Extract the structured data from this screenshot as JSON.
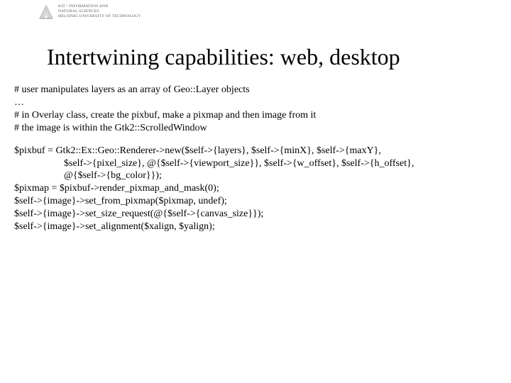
{
  "header": {
    "affil_line1": "KIT / INFORMATION AND",
    "affil_line2": "NATURAL SCIENCES",
    "affil_line3": "HELSINKI UNIVERSITY OF TECHNOLOGY"
  },
  "title": "Intertwining capabilities: web, desktop",
  "comments": {
    "c1": "# user manipulates layers as an array of Geo::Layer objects",
    "ellipsis": "…",
    "c2": "# in Overlay class, create the pixbuf, make a pixmap and then image from it",
    "c3": "# the image is within the Gtk2::ScrolledWindow"
  },
  "code": {
    "l1": "$pixbuf = Gtk2::Ex::Geo::Renderer->new($self->{layers}, $self->{minX}, $self->{maxY},",
    "l2": "$self->{pixel_size}, @{$self->{viewport_size}}, $self->{w_offset}, $self->{h_offset},",
    "l3": "@{$self->{bg_color}});",
    "l4": "$pixmap = $pixbuf->render_pixmap_and_mask(0);",
    "l5": "$self->{image}->set_from_pixmap($pixmap, undef);",
    "l6": "$self->{image}->set_size_request(@{$self->{canvas_size}});",
    "l7": "$self->{image}->set_alignment($xalign, $yalign);"
  }
}
